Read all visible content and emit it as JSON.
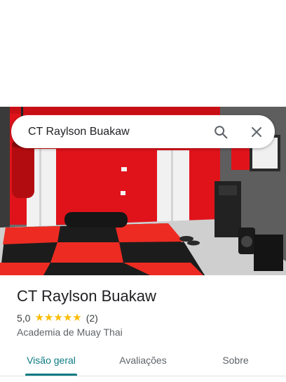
{
  "search": {
    "query": "CT Raylson Buakaw",
    "search_icon": "search-icon",
    "close_icon": "close-icon"
  },
  "place": {
    "title": "CT Raylson Buakaw",
    "rating": "5,0",
    "stars": 5,
    "review_count": "(2)",
    "category": "Academia de Muay Thai"
  },
  "tabs": [
    {
      "label": "Visão geral",
      "active": true
    },
    {
      "label": "Avaliações",
      "active": false
    },
    {
      "label": "Sobre",
      "active": false
    }
  ],
  "colors": {
    "accent": "#0b7a83",
    "star": "#fbbc04",
    "wall_red": "#e0131b",
    "mat_red": "#ee2b22",
    "mat_black": "#1c1c1c"
  }
}
